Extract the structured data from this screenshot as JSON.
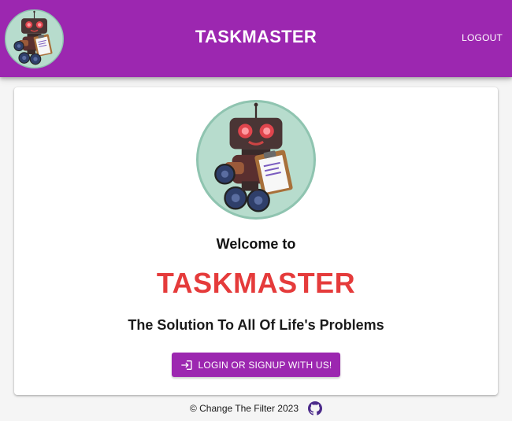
{
  "header": {
    "title": "TASKMASTER",
    "logout_label": "LOGOUT",
    "logo_icon": "robot-logo-icon"
  },
  "main": {
    "welcome": "Welcome to",
    "brand": "TASKMASTER",
    "tagline": "The Solution To All Of Life's Problems",
    "cta_label": "LOGIN OR SIGNUP WITH US!",
    "cta_icon": "login-icon",
    "hero_icon": "robot-hero-icon"
  },
  "footer": {
    "copyright": "© Change The Filter 2023",
    "github_icon": "github-icon"
  },
  "colors": {
    "primary": "#9c27b0",
    "brand_red": "#e53b3b",
    "background": "#f5f5f5"
  }
}
